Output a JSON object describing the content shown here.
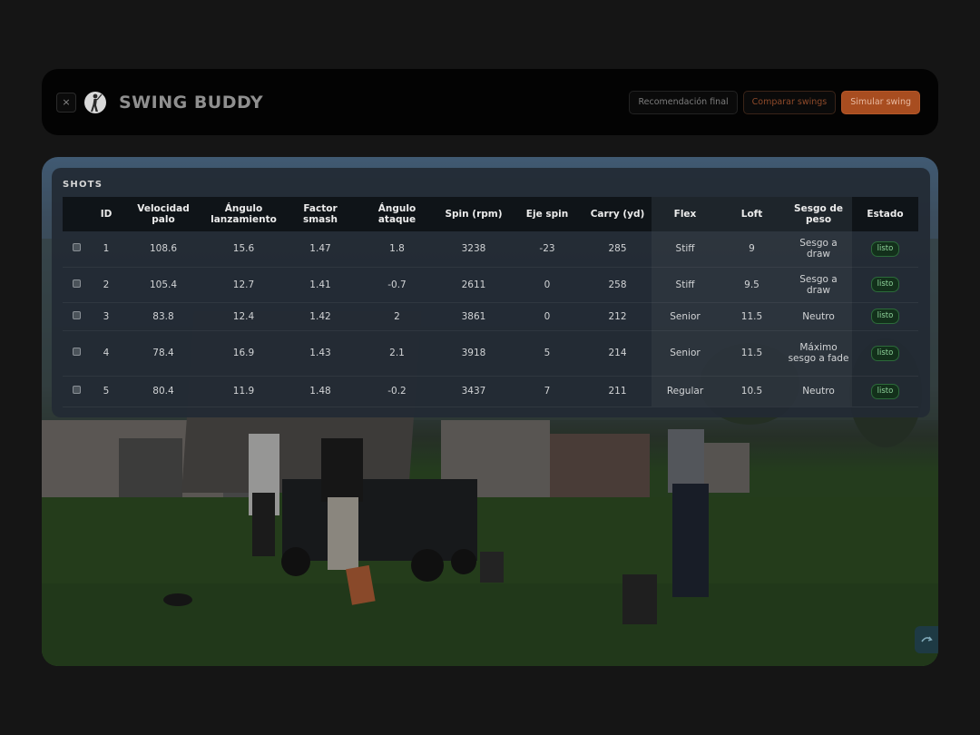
{
  "header": {
    "close_label": "×",
    "brand": "SWING BUDDY",
    "buttons": {
      "final": "Recomendación final",
      "compare": "Comparar swings",
      "simulate": "Simular swing"
    }
  },
  "shots": {
    "title": "SHOTS",
    "columns": [
      "ID",
      "Velocidad palo",
      "Ángulo lanzamiento",
      "Factor smash",
      "Ángulo ataque",
      "Spin (rpm)",
      "Eje spin",
      "Carry (yd)",
      "Flex",
      "Loft",
      "Sesgo de peso",
      "Estado"
    ],
    "rows": [
      {
        "id": "1",
        "velocidad": "108.6",
        "lanzamiento": "15.6",
        "smash": "1.47",
        "ataque": "1.8",
        "spin": "3238",
        "eje": "-23",
        "carry": "285",
        "flex": "Stiff",
        "loft": "9",
        "sesgo": "Sesgo a draw",
        "estado": "listo"
      },
      {
        "id": "2",
        "velocidad": "105.4",
        "lanzamiento": "12.7",
        "smash": "1.41",
        "ataque": "-0.7",
        "spin": "2611",
        "eje": "0",
        "carry": "258",
        "flex": "Stiff",
        "loft": "9.5",
        "sesgo": "Sesgo a draw",
        "estado": "listo"
      },
      {
        "id": "3",
        "velocidad": "83.8",
        "lanzamiento": "12.4",
        "smash": "1.42",
        "ataque": "2",
        "spin": "3861",
        "eje": "0",
        "carry": "212",
        "flex": "Senior",
        "loft": "11.5",
        "sesgo": "Neutro",
        "estado": "listo"
      },
      {
        "id": "4",
        "velocidad": "78.4",
        "lanzamiento": "16.9",
        "smash": "1.43",
        "ataque": "2.1",
        "spin": "3918",
        "eje": "5",
        "carry": "214",
        "flex": "Senior",
        "loft": "11.5",
        "sesgo": "Máximo sesgo a fade",
        "estado": "listo"
      },
      {
        "id": "5",
        "velocidad": "80.4",
        "lanzamiento": "11.9",
        "smash": "1.48",
        "ataque": "-0.2",
        "spin": "3437",
        "eje": "7",
        "carry": "211",
        "flex": "Regular",
        "loft": "10.5",
        "sesgo": "Neutro",
        "estado": "listo"
      }
    ]
  },
  "colors": {
    "accent": "#a84d20",
    "status_ok": "#8fd39b",
    "background": "#151515"
  },
  "icons": {
    "close": "close-icon",
    "logo": "golfer-logo-icon",
    "fab": "swap-icon"
  }
}
